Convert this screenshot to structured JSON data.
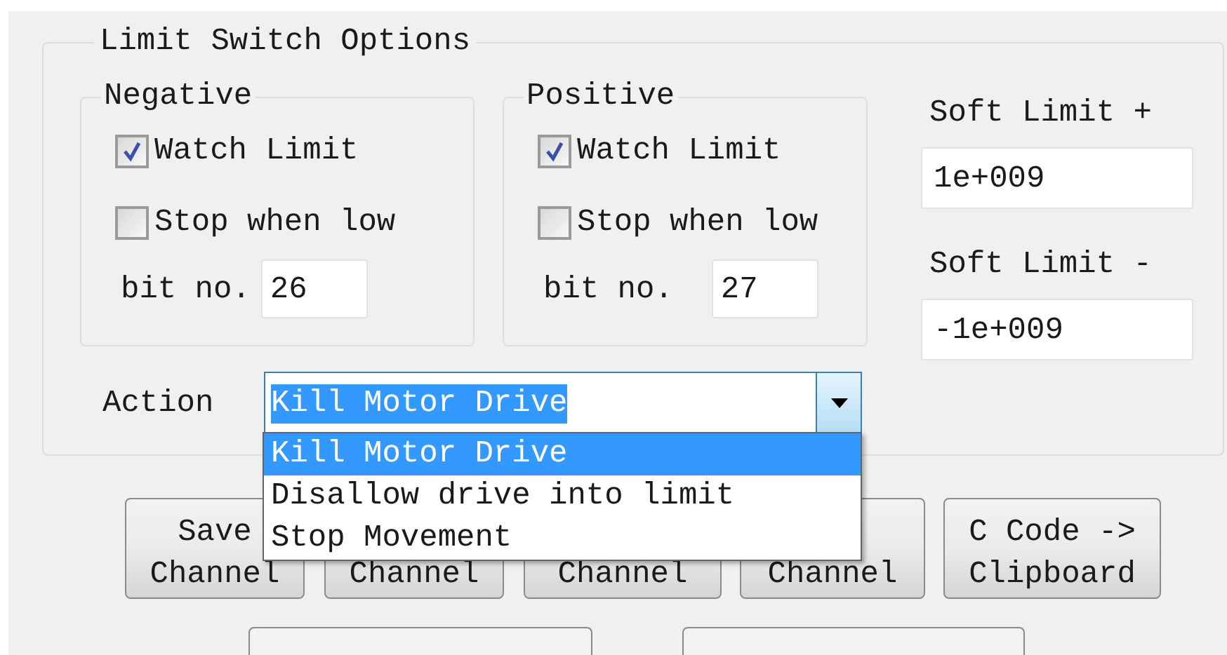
{
  "group": {
    "title": "Limit Switch Options"
  },
  "limits": [
    {
      "title": "Negative",
      "watch": {
        "label": "Watch Limit",
        "checked": true
      },
      "stop": {
        "label": "Stop when low",
        "checked": false
      },
      "bit_label": "bit no.",
      "bit_value": "26"
    },
    {
      "title": "Positive",
      "watch": {
        "label": "Watch Limit",
        "checked": true
      },
      "stop": {
        "label": "Stop when low",
        "checked": false
      },
      "bit_label": "bit no.",
      "bit_value": "27"
    }
  ],
  "soft_limits": [
    {
      "label": "Soft Limit +",
      "value": "1e+009"
    },
    {
      "label": "Soft Limit -",
      "value": "-1e+009"
    }
  ],
  "action": {
    "label": "Action",
    "value": "Kill Motor Drive",
    "expanded": true,
    "options": [
      {
        "label": "Kill Motor Drive",
        "selected": true
      },
      {
        "label": "Disallow drive into limit",
        "selected": false
      },
      {
        "label": "Stop Movement",
        "selected": false
      }
    ]
  },
  "buttons": [
    {
      "label": "Save\nChannel"
    },
    {
      "label": "Channel"
    },
    {
      "label": "Channel"
    },
    {
      "label": "Channel"
    },
    {
      "label": "C Code ->\nClipboard"
    }
  ]
}
